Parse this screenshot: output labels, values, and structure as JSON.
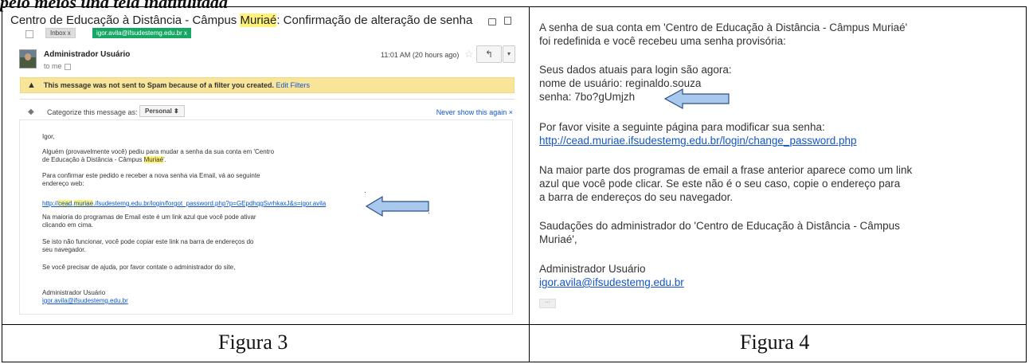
{
  "top_clip_text": "pelo meios una tela inatituitada",
  "figura3": {
    "caption": "Figura 3",
    "subject_before": "Centro de Educação à Distância - Câmpus ",
    "subject_highlight": "Muriaé",
    "subject_after": ": Confirmação de alteração de senha",
    "tag_inbox": "Inbox  x",
    "tag_label": "igor.avila@ifsudestemg.edu.br  x",
    "sender": "Administrador Usuário",
    "to_me": "to me",
    "time": "11:01 AM (20 hours ago)",
    "reply_icon": "reply-icon",
    "spam_notice": "This message was not sent to Spam because of a filter you created.",
    "spam_edit": "Edit Filters",
    "categorize_label": "Categorize this message as:",
    "categorize_value": "Personal ⬍",
    "never_show": "Never show this again  ×",
    "greeting": "Igor,",
    "para1_line1": "Alguém (provavelmente você) pediu para mudar a senha da sua conta em 'Centro",
    "para1_line2_before": "de Educação à Distância - Câmpus ",
    "para1_line2_hl": "Muriaé",
    "para1_line2_after": "'.",
    "para2_line1": "Para confirmar este pedido e receber a nova senha via Email, vá ao seguinte",
    "para2_line2": "endereço web:",
    "link_before": "http://",
    "link_hl1": "cead",
    "link_dot": ".",
    "link_hl2": "muriae",
    "link_after": ".ifsudestemg.edu.br/login/forgot_password.php?p=GEpdhqgSvrhkaxJ&s=igor.avila",
    "para3_line1": "Na maioria do programas de Email este é um link azul que você pode ativar",
    "para3_line2": "clicando em cima.",
    "para4_line1": "Se isto não funcionar, você pode copiar este link na barra de endereços do",
    "para4_line2": "seu navegador.",
    "para5": "Se você precisar de ajuda, por favor contate o administrador do site,",
    "signature_name": "Administrador Usuário",
    "signature_email": "igor.avila@ifsudestemg.edu.br"
  },
  "figura4": {
    "caption": "Figura 4",
    "line1": "A senha de sua conta em 'Centro de Educação à Distância - Câmpus Muriaé'",
    "line2": "foi redefinida e você recebeu uma senha provisória:",
    "line3": "Seus dados atuais para login são agora:",
    "line4": "nome de usuário: reginaldo.souza",
    "line5": "senha: 7bo?gUmjzh",
    "line6": "Por favor visite a seguinte página para modificar sua senha:",
    "link": "http://cead.muriae.ifsudestemg.edu.br/login/change_password.php",
    "line7": "Na maior parte dos programas de email a frase anterior aparece como um link",
    "line8": "azul que você pode clicar. Se este não é o seu caso, copie o endereço para",
    "line9": "a barra de endereços do seu navegador.",
    "line10": "Saudações do administrador do 'Centro de Educação à Distância - Câmpus",
    "line11": "Muriaé',",
    "signature_name": "Administrador Usuário",
    "signature_email": "igor.avila@ifsudestemg.edu.br",
    "ellipsis": "···"
  },
  "colors": {
    "link": "#1155cc",
    "highlight": "#fff27a",
    "spam_bg": "#f9e59a",
    "arrow_fill": "#a9c8ee",
    "arrow_stroke": "#2a4f85",
    "label_green": "#16a765"
  }
}
